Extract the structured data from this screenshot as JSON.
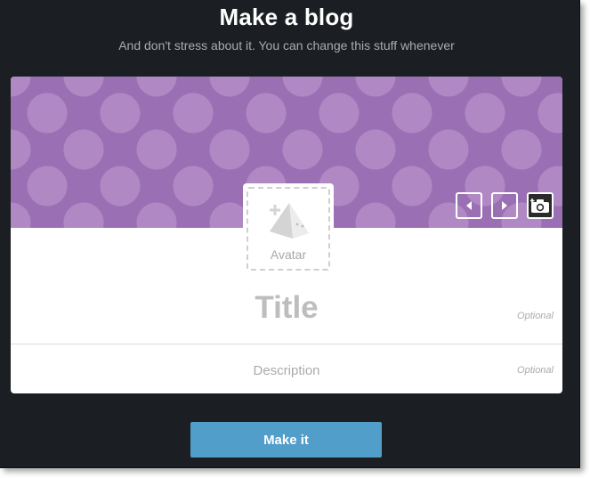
{
  "heading": "Make a blog",
  "subheading": "And don't stress about it. You can change this stuff whenever",
  "header": {
    "prev_icon": "triangle-left-icon",
    "next_icon": "triangle-right-icon",
    "camera_icon": "camera-icon",
    "pattern_color": "#9b6fb3",
    "dot_color": "#b089c4"
  },
  "avatar": {
    "label": "Avatar",
    "icon": "pyramid-plus-icon"
  },
  "title_field": {
    "placeholder": "Title",
    "optional_label": "Optional"
  },
  "description_field": {
    "placeholder": "Description",
    "optional_label": "Optional"
  },
  "submit": {
    "label": "Make it",
    "color": "#529ecb"
  }
}
